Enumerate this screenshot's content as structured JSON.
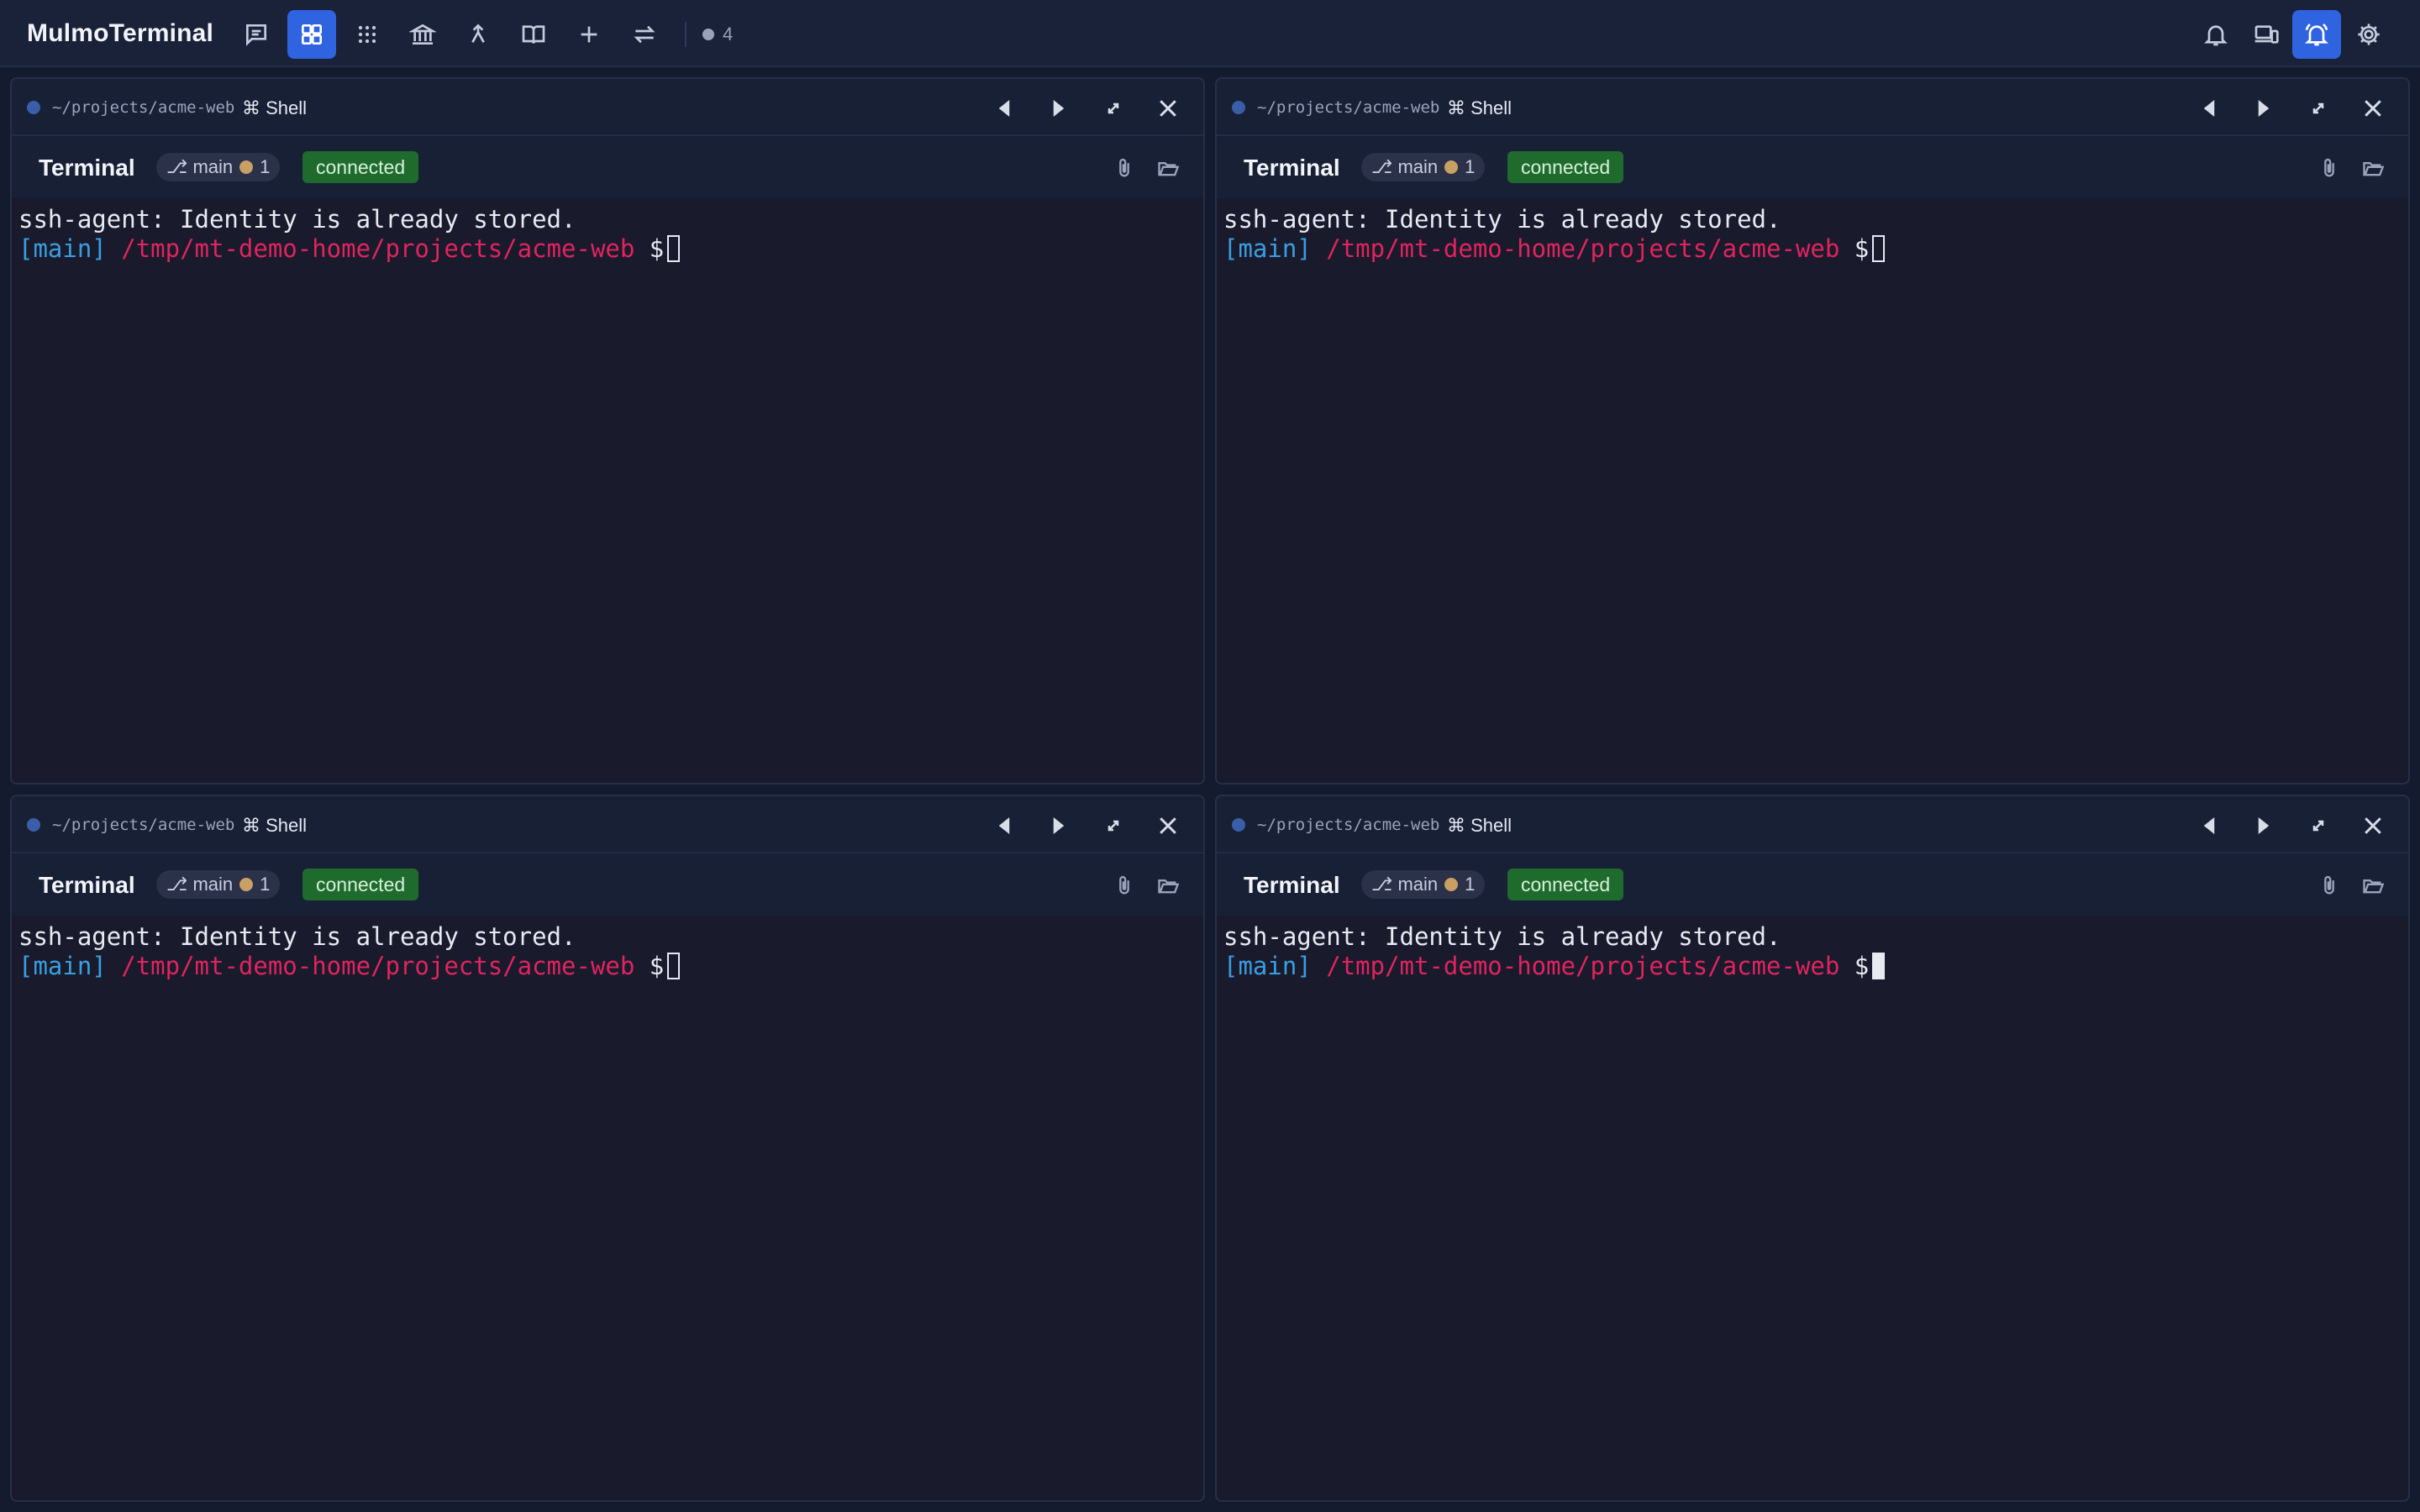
{
  "app": {
    "title": "MulmoTerminal"
  },
  "topbar": {
    "left_icons": [
      {
        "name": "chat-icon"
      },
      {
        "name": "grid-layout-icon",
        "active": true
      },
      {
        "name": "apps-grid-icon"
      },
      {
        "name": "bank-icon"
      },
      {
        "name": "merge-icon"
      },
      {
        "name": "book-icon"
      },
      {
        "name": "plus-icon"
      },
      {
        "name": "swap-icon"
      }
    ],
    "session_count": "4",
    "right_icons": [
      {
        "name": "bell-icon"
      },
      {
        "name": "devices-icon"
      },
      {
        "name": "bell-ring-icon",
        "active": true
      },
      {
        "name": "gear-icon"
      }
    ]
  },
  "panes": [
    {
      "path": "~/projects/acme-web",
      "command": "⌘ Shell",
      "label": "Terminal",
      "branch": "⎇ main",
      "modified": "1",
      "status": "connected",
      "lines": {
        "line1": "ssh-agent: Identity is already stored.",
        "branch_tag": "[main]",
        "cwd": "/tmp/mt-demo-home/projects/acme-web",
        "prompt": "$"
      },
      "cursor_focused": false
    },
    {
      "path": "~/projects/acme-web",
      "command": "⌘ Shell",
      "label": "Terminal",
      "branch": "⎇ main",
      "modified": "1",
      "status": "connected",
      "lines": {
        "line1": "ssh-agent: Identity is already stored.",
        "branch_tag": "[main]",
        "cwd": "/tmp/mt-demo-home/projects/acme-web",
        "prompt": "$"
      },
      "cursor_focused": false
    },
    {
      "path": "~/projects/acme-web",
      "command": "⌘ Shell",
      "label": "Terminal",
      "branch": "⎇ main",
      "modified": "1",
      "status": "connected",
      "lines": {
        "line1": "ssh-agent: Identity is already stored.",
        "branch_tag": "[main]",
        "cwd": "/tmp/mt-demo-home/projects/acme-web",
        "prompt": "$"
      },
      "cursor_focused": false
    },
    {
      "path": "~/projects/acme-web",
      "command": "⌘ Shell",
      "label": "Terminal",
      "branch": "⎇ main",
      "modified": "1",
      "status": "connected",
      "lines": {
        "line1": "ssh-agent: Identity is already stored.",
        "branch_tag": "[main]",
        "cwd": "/tmp/mt-demo-home/projects/acme-web",
        "prompt": "$"
      },
      "cursor_focused": true
    }
  ],
  "colors": {
    "accent": "#2f63e0",
    "status_connected": "#1f6b2e",
    "prompt_branch": "#3a9fe0",
    "prompt_path": "#e0245e",
    "modified_dot": "#c9a064"
  }
}
